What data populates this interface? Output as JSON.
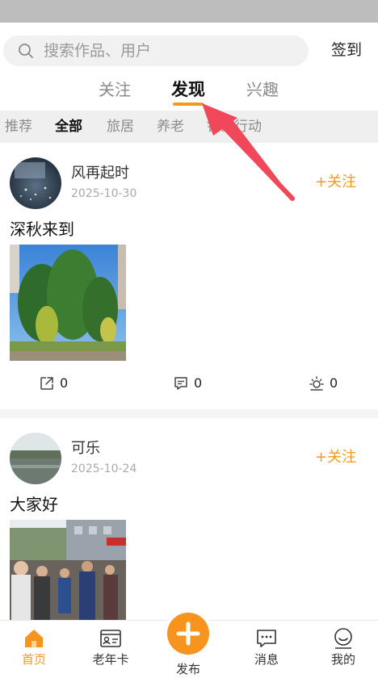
{
  "search": {
    "placeholder": "搜索作品、用户",
    "signin_label": "签到"
  },
  "main_tabs": [
    {
      "label": "关注",
      "active": false
    },
    {
      "label": "发现",
      "active": true
    },
    {
      "label": "兴趣",
      "active": false
    }
  ],
  "sub_tabs": [
    {
      "label": "推荐",
      "active": false
    },
    {
      "label": "全部",
      "active": true
    },
    {
      "label": "旅居",
      "active": false
    },
    {
      "label": "养老",
      "active": false
    },
    {
      "label": "银龄行动",
      "active": false
    }
  ],
  "posts": [
    {
      "author": "风再起时",
      "date": "2025-10-30",
      "follow_label": "+关注",
      "title": "深秋来到",
      "share_count": "0",
      "comment_count": "0",
      "like_count": "0"
    },
    {
      "author": "可乐",
      "date": "2025-10-24",
      "follow_label": "+关注",
      "title": "大家好"
    }
  ],
  "bottom_nav": [
    {
      "label": "首页",
      "icon": "home-icon",
      "active": true
    },
    {
      "label": "老年卡",
      "icon": "id-card-icon",
      "active": false
    },
    {
      "label": "发布",
      "icon": "plus-icon",
      "active": false
    },
    {
      "label": "消息",
      "icon": "message-icon",
      "active": false
    },
    {
      "label": "我的",
      "icon": "profile-icon",
      "active": false
    }
  ],
  "colors": {
    "accent": "#f39a1c",
    "publish": "#f7941d",
    "annotation_arrow": "#f0485a"
  }
}
